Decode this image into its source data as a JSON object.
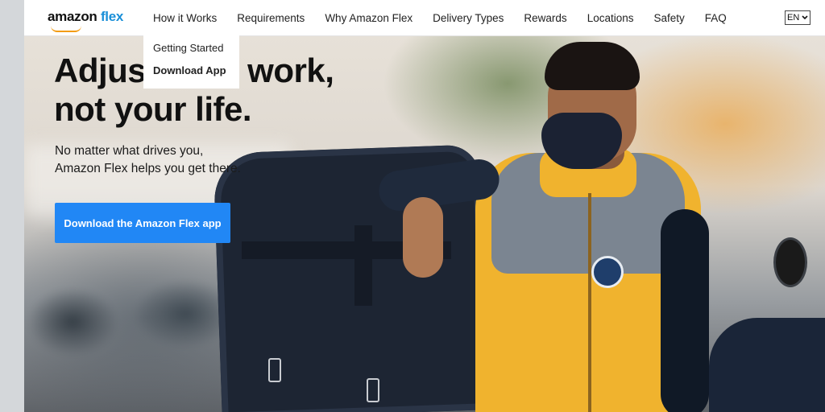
{
  "logo": {
    "brand": "amazon",
    "product": "flex"
  },
  "nav": {
    "links": [
      "How it Works",
      "Requirements",
      "Why Amazon Flex",
      "Delivery Types",
      "Rewards",
      "Locations",
      "Safety",
      "FAQ"
    ],
    "language": "EN"
  },
  "dropdown": {
    "items": [
      "Getting Started",
      "Download App"
    ]
  },
  "hero": {
    "headline_line1_start": "Adjus",
    "headline_line1_end": "work,",
    "headline_line2": "not your life.",
    "subtext_line1": "No matter what drives you,",
    "subtext_line2": "Amazon Flex helps you get there.",
    "cta_label": "Download the Amazon Flex app"
  },
  "colors": {
    "accent": "#2187f5",
    "brand_flex": "#1a8fd8",
    "smile": "#f39c12"
  },
  "icons": {
    "language_chevron": "chevron-down-icon",
    "logo_smile": "smile-arrow-icon"
  }
}
